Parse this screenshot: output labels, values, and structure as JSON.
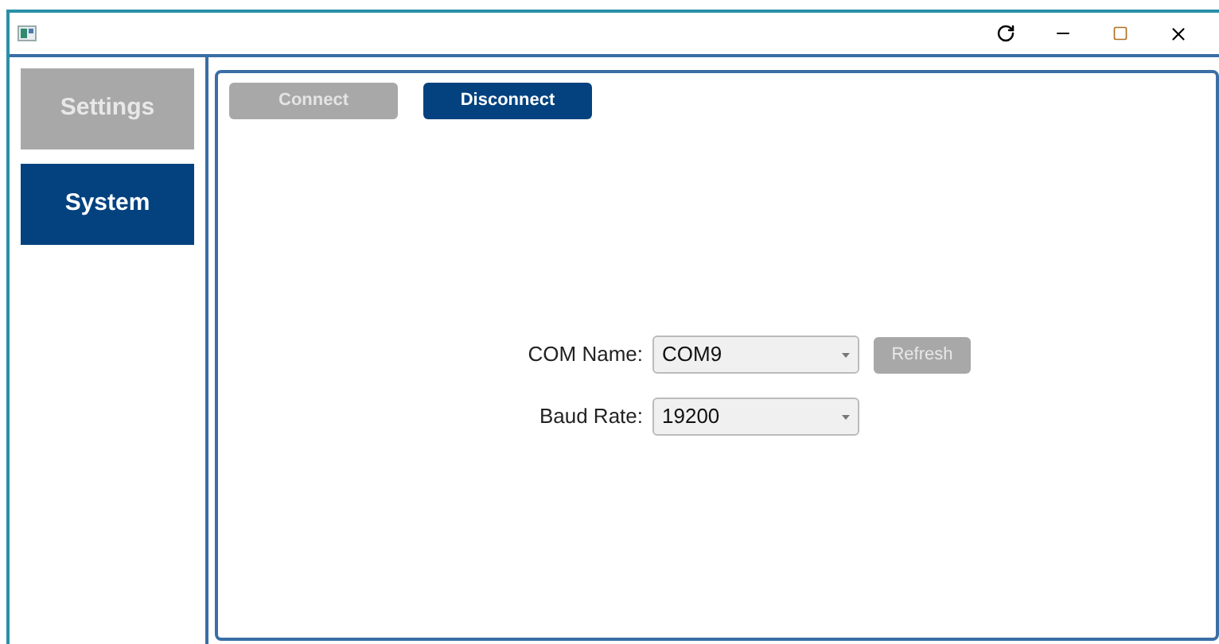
{
  "nav": [
    {
      "label": "Settings",
      "selected": false
    },
    {
      "label": "System",
      "selected": true
    }
  ],
  "actions": [
    {
      "label": "Connect",
      "disabled": true
    },
    {
      "label": "Disconnect",
      "disabled": false
    }
  ],
  "fields": [
    {
      "label": "COM Name:",
      "value": "COM9",
      "button": {
        "label": "Refresh",
        "disabled": true
      }
    },
    {
      "label": "Baud Rate:",
      "value": "19200"
    }
  ]
}
